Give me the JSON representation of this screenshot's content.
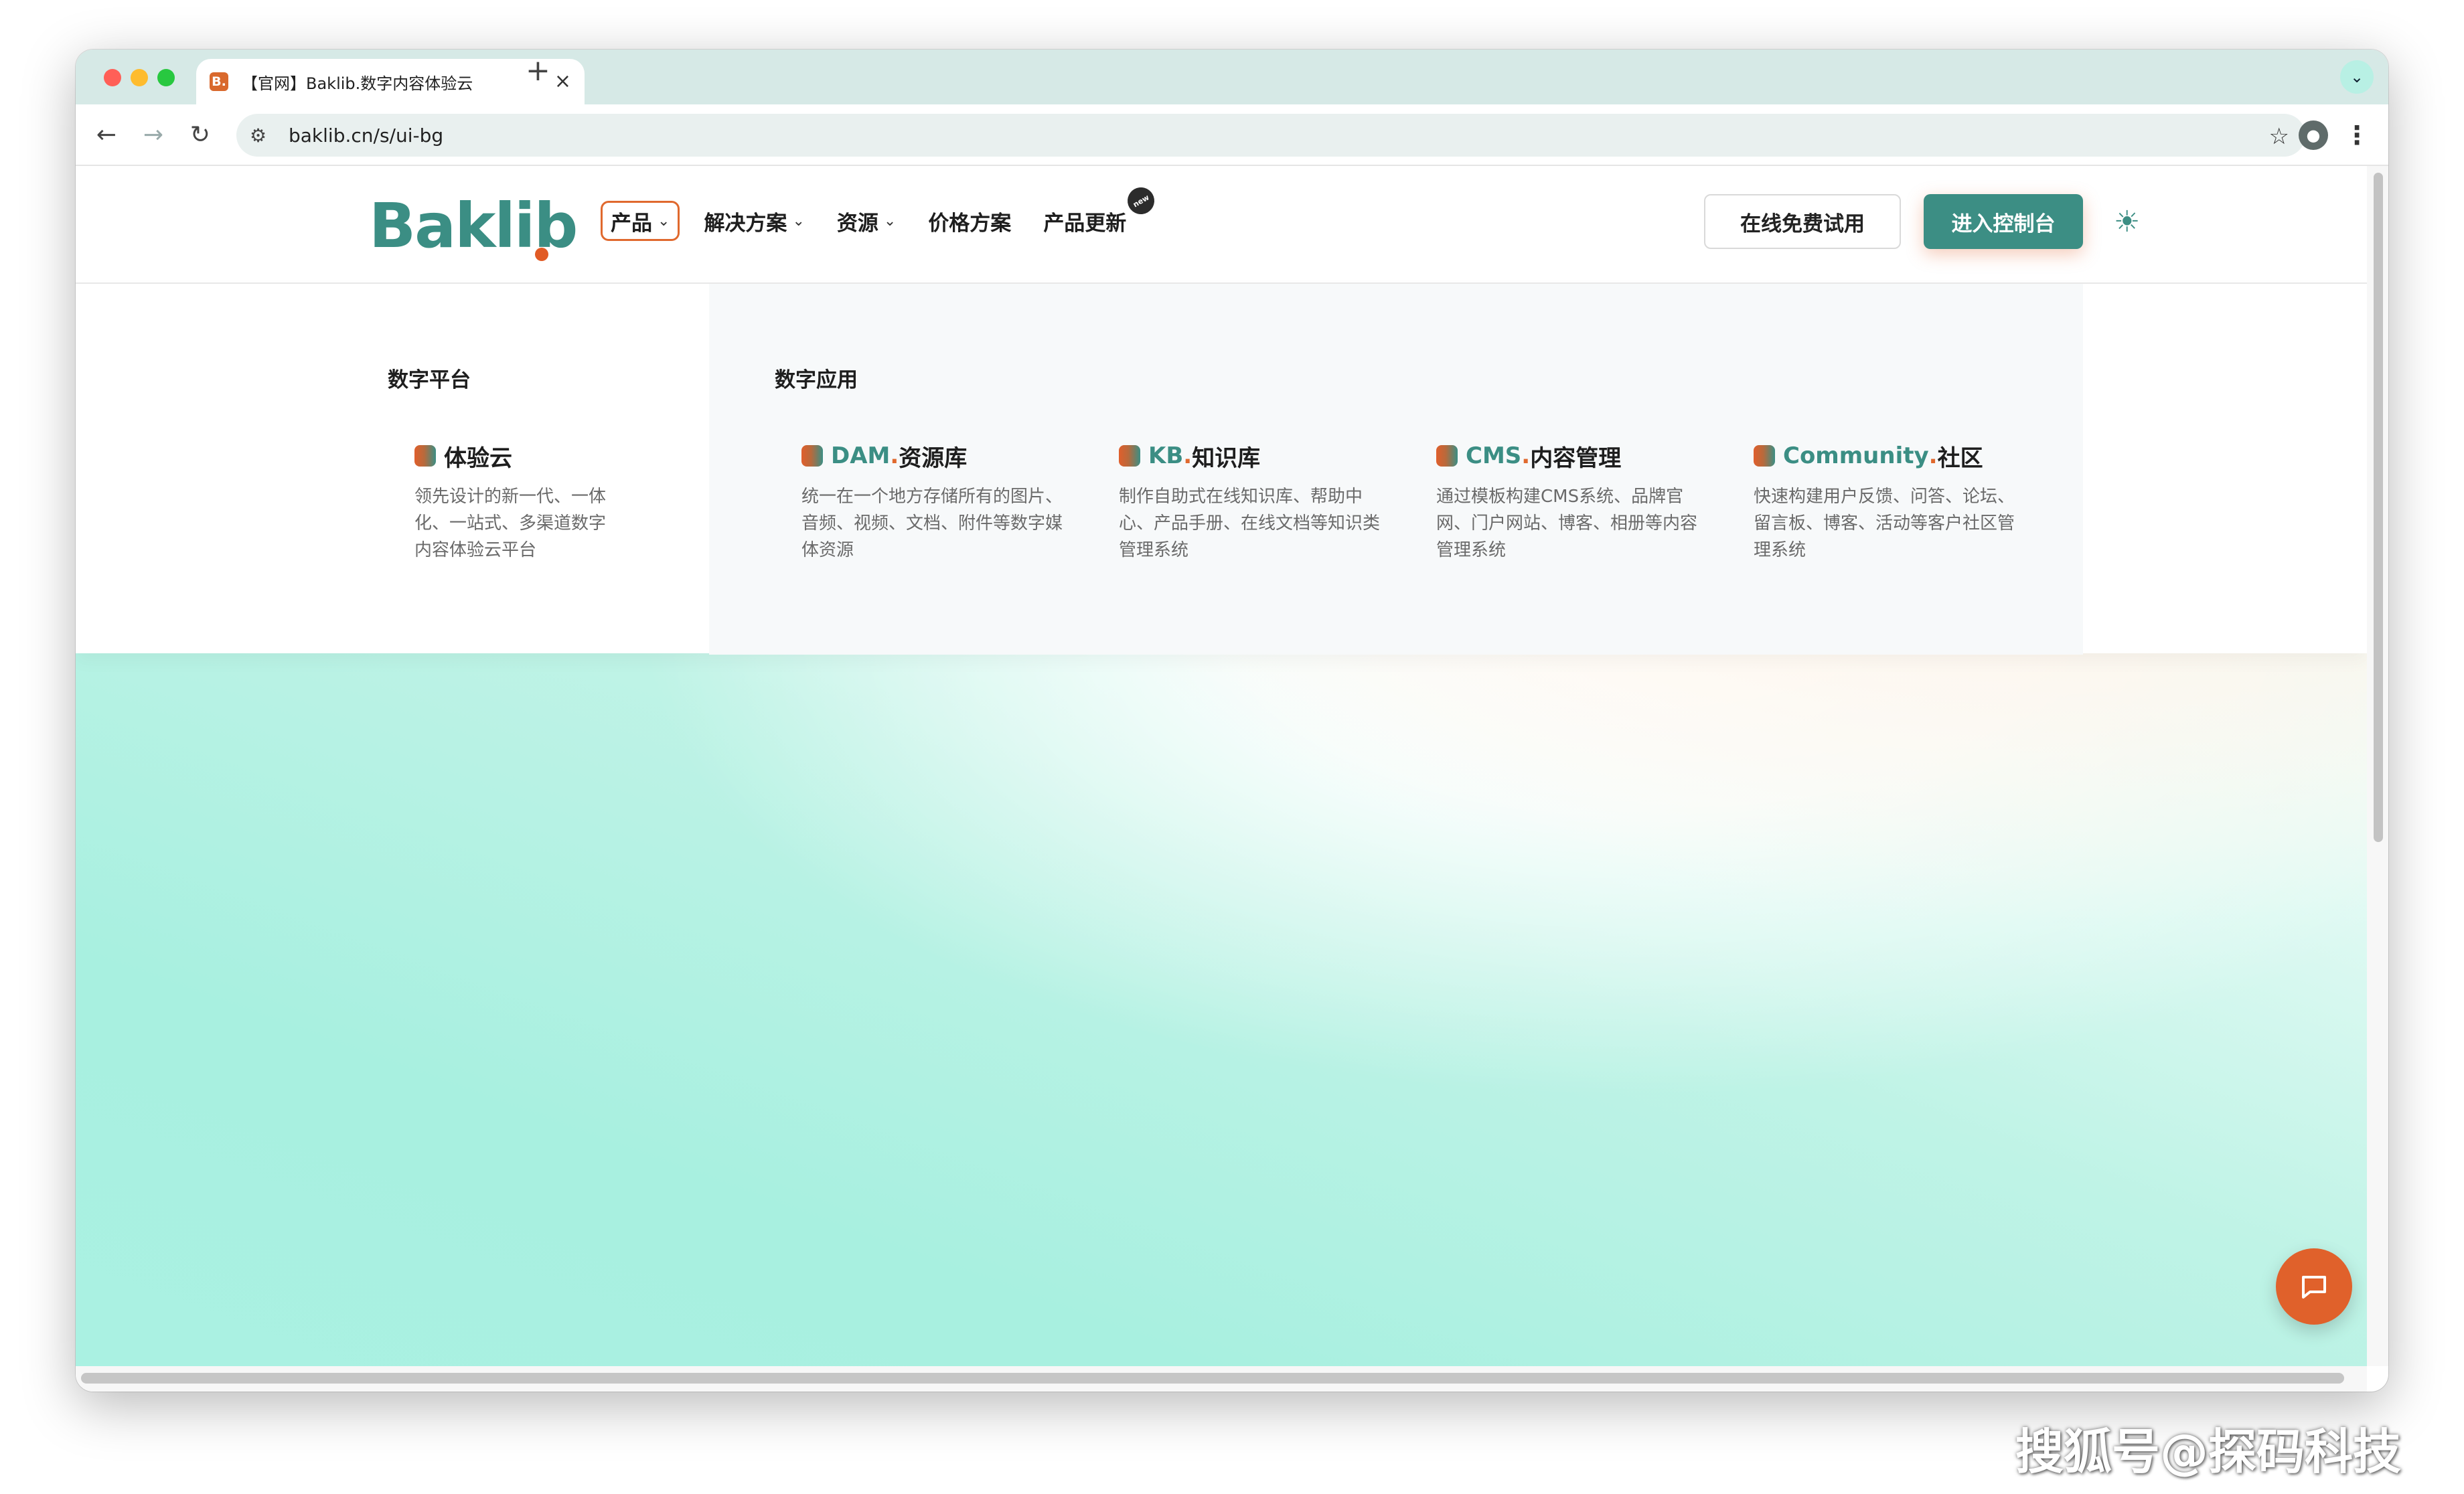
{
  "browser": {
    "tab": {
      "favicon_text": "B.",
      "title": "【官网】Baklib.数字内容体验云",
      "close_glyph": "×"
    },
    "new_tab_glyph": "+",
    "tab_search_glyph": "⌄",
    "toolbar": {
      "back_glyph": "←",
      "forward_glyph": "→",
      "reload_glyph": "↻",
      "site_info_glyph": "⚙",
      "url": "baklib.cn/s/ui-bg",
      "bookmark_glyph": "☆",
      "profile_glyph": "●",
      "menu_glyph": "⋮"
    }
  },
  "site": {
    "logo": "Baklib",
    "nav": [
      {
        "label": "产品",
        "chevron": "⌄"
      },
      {
        "label": "解决方案",
        "chevron": "⌄"
      },
      {
        "label": "资源",
        "chevron": "⌄"
      },
      {
        "label": "价格方案"
      },
      {
        "label": "产品更新",
        "badge": "new"
      }
    ],
    "trial_button": "在线免费试用",
    "console_button": "进入控制台",
    "theme_glyph": "☀"
  },
  "mega_menu": {
    "platform": {
      "title": "数字平台",
      "items": [
        {
          "prefix": "",
          "dot": "",
          "name": "体验云",
          "desc": "领先设计的新一代、一体化、一站式、多渠道数字内容体验云平台"
        }
      ]
    },
    "apps": {
      "title": "数字应用",
      "items": [
        {
          "prefix": "DAM",
          "dot": ".",
          "name": "资源库",
          "desc": "统一在一个地方存储所有的图片、音频、视频、文档、附件等数字媒体资源"
        },
        {
          "prefix": "KB",
          "dot": ".",
          "name": "知识库",
          "desc": "制作自助式在线知识库、帮助中心、产品手册、在线文档等知识类管理系统"
        },
        {
          "prefix": "CMS",
          "dot": ".",
          "name": "内容管理",
          "desc": "通过模板构建CMS系统、品牌官网、门户网站、博客、相册等内容管理系统"
        },
        {
          "prefix": "Community",
          "dot": ".",
          "name": "社区",
          "desc": "快速构建用户反馈、问答、论坛、留言板、博客、活动等客户社区管理系统"
        }
      ]
    }
  },
  "watermark": "搜狐号@探码科技",
  "colors": {
    "brand_teal": "#3b8e84",
    "brand_orange": "#e0692e",
    "chat_fab": "#e0612b"
  },
  "icons": {
    "chat": "chat-bubble-icon",
    "theme": "sun-icon"
  }
}
